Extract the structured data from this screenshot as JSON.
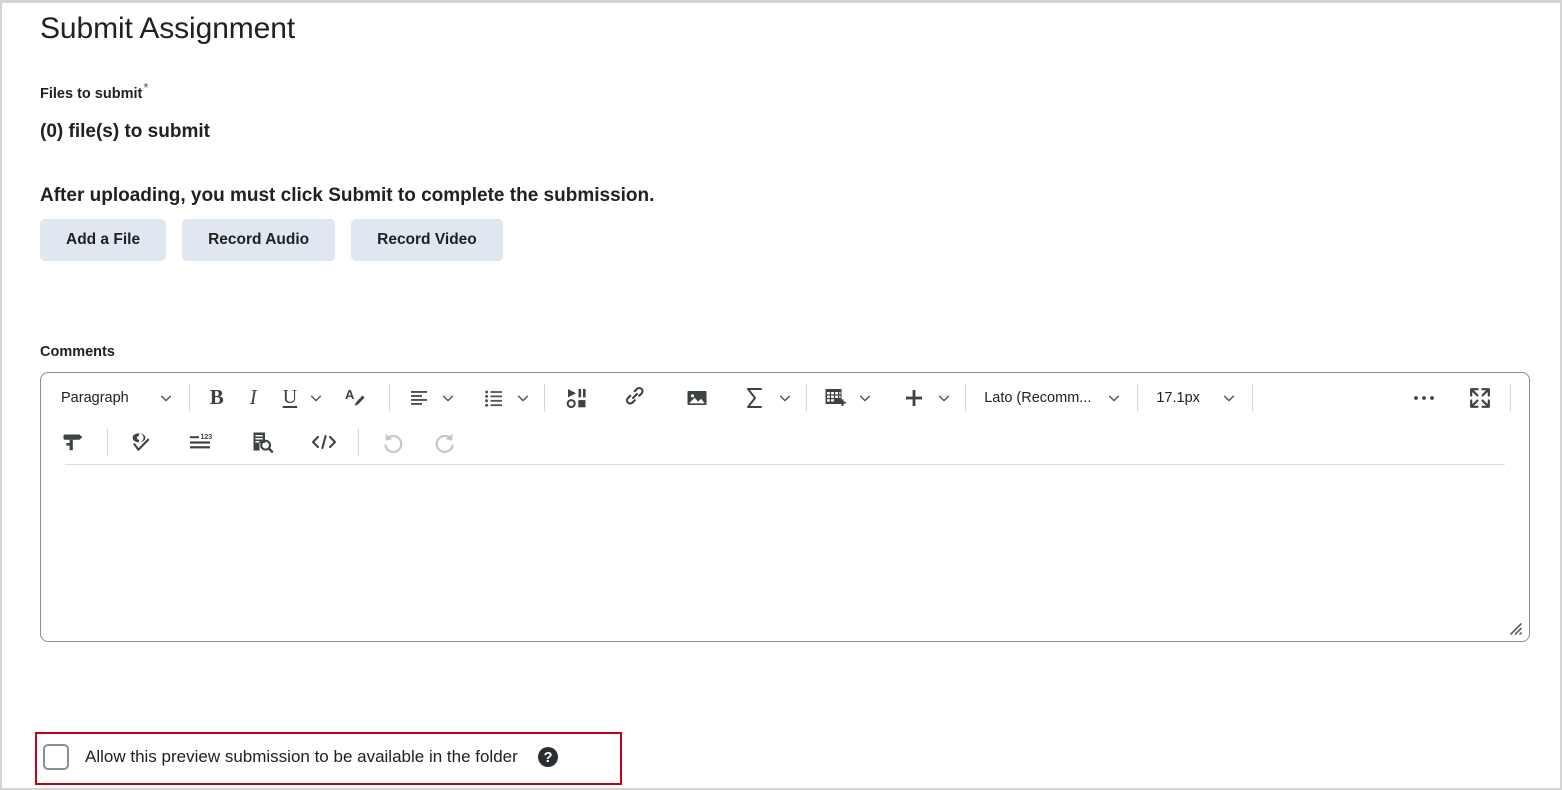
{
  "page": {
    "title": "Submit Assignment"
  },
  "files_section": {
    "label": "Files to submit",
    "required_marker": "*",
    "file_count_text": "(0) file(s) to submit",
    "upload_note": "After uploading, you must click Submit to complete the submission.",
    "buttons": [
      {
        "label": "Add a File",
        "name": "add-a-file-button"
      },
      {
        "label": "Record Audio",
        "name": "record-audio-button"
      },
      {
        "label": "Record Video",
        "name": "record-video-button"
      }
    ]
  },
  "comments_section": {
    "label": "Comments",
    "editor": {
      "content": "",
      "toolbar_row1": {
        "paragraph_style": "Paragraph",
        "bold": "B",
        "italic": "I",
        "underline": "U",
        "font_name": "Lato (Recomm...",
        "font_size": "17.1px"
      },
      "icons_row1": [
        "paragraph-style-dropdown",
        "bold-icon",
        "italic-icon",
        "underline-icon",
        "text-color-icon",
        "align-left-icon",
        "bullet-list-icon",
        "insert-stuff-icon",
        "insert-link-icon",
        "insert-image-icon",
        "equation-icon",
        "insert-table-icon",
        "insert-more-icon",
        "font-name-dropdown",
        "font-size-dropdown",
        "more-options-icon",
        "fullscreen-icon"
      ],
      "icons_row2": [
        "format-painter-icon",
        "accessibility-checker-icon",
        "word-count-icon",
        "preview-icon",
        "html-source-icon",
        "undo-icon",
        "redo-icon"
      ],
      "resize_handle": "resize-grip"
    }
  },
  "preview_option": {
    "checkbox_checked": false,
    "label": "Allow this preview submission to be available in the folder",
    "help_icon": "help-icon"
  },
  "colors": {
    "button_bg": "#e1e7f0",
    "highlight_border": "#c00418",
    "icon": "#4f5356",
    "text": "#202122",
    "editor_border": "#8a8f92"
  }
}
